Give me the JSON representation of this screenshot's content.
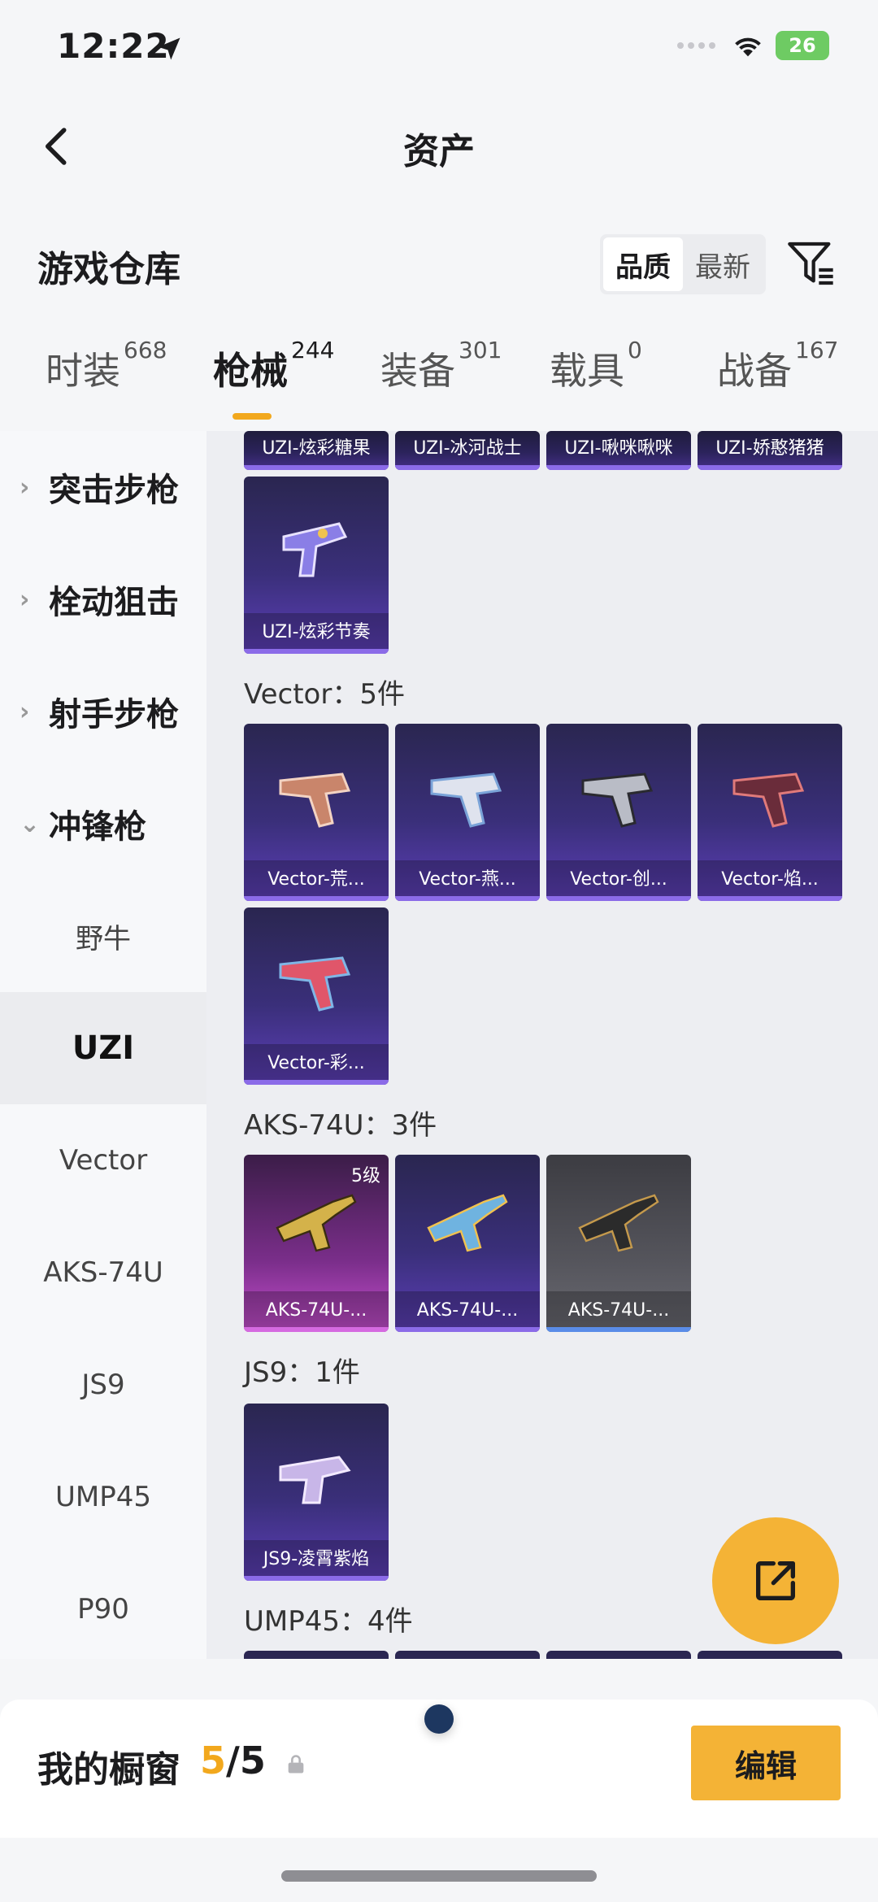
{
  "status_bar": {
    "time": "12:22",
    "battery": "26"
  },
  "header": {
    "title": "资产"
  },
  "warehouse": {
    "title": "游戏仓库",
    "sort_options": [
      "品质",
      "最新"
    ],
    "active_sort": "品质"
  },
  "tabs": [
    {
      "label": "时装",
      "count": "668"
    },
    {
      "label": "枪械",
      "count": "244"
    },
    {
      "label": "装备",
      "count": "301"
    },
    {
      "label": "载具",
      "count": "0"
    },
    {
      "label": "战备",
      "count": "167"
    }
  ],
  "sidebar": {
    "parents": [
      "突击步枪",
      "栓动狙击",
      "射手步枪",
      "冲锋枪"
    ],
    "children": [
      "野牛",
      "UZI",
      "Vector",
      "AKS-74U",
      "JS9",
      "UMP45",
      "P90"
    ],
    "selected": "UZI"
  },
  "content": {
    "uzi_row_partial": [
      "UZI-炫彩糖果",
      "UZI-冰河战士",
      "UZI-啾咪啾咪",
      "UZI-娇憨猪猪"
    ],
    "uzi_more": [
      "UZI-炫彩节奏"
    ],
    "vector": {
      "title": "Vector：5件",
      "items": [
        "Vector-荒...",
        "Vector-燕...",
        "Vector-创...",
        "Vector-焰...",
        "Vector-彩..."
      ]
    },
    "aks": {
      "title": "AKS-74U：3件",
      "items": [
        "AKS-74U-...",
        "AKS-74U-...",
        "AKS-74U-..."
      ],
      "level_badge": "5级"
    },
    "js9": {
      "title": "JS9：1件",
      "items": [
        "JS9-凌霄紫焰"
      ]
    },
    "ump45": {
      "title": "UMP45：4件"
    }
  },
  "showcase": {
    "title": "我的橱窗",
    "current": "5",
    "total": "/5",
    "edit_label": "编辑"
  },
  "colors": {
    "accent": "#f2a81d",
    "fab": "#f4b336"
  }
}
